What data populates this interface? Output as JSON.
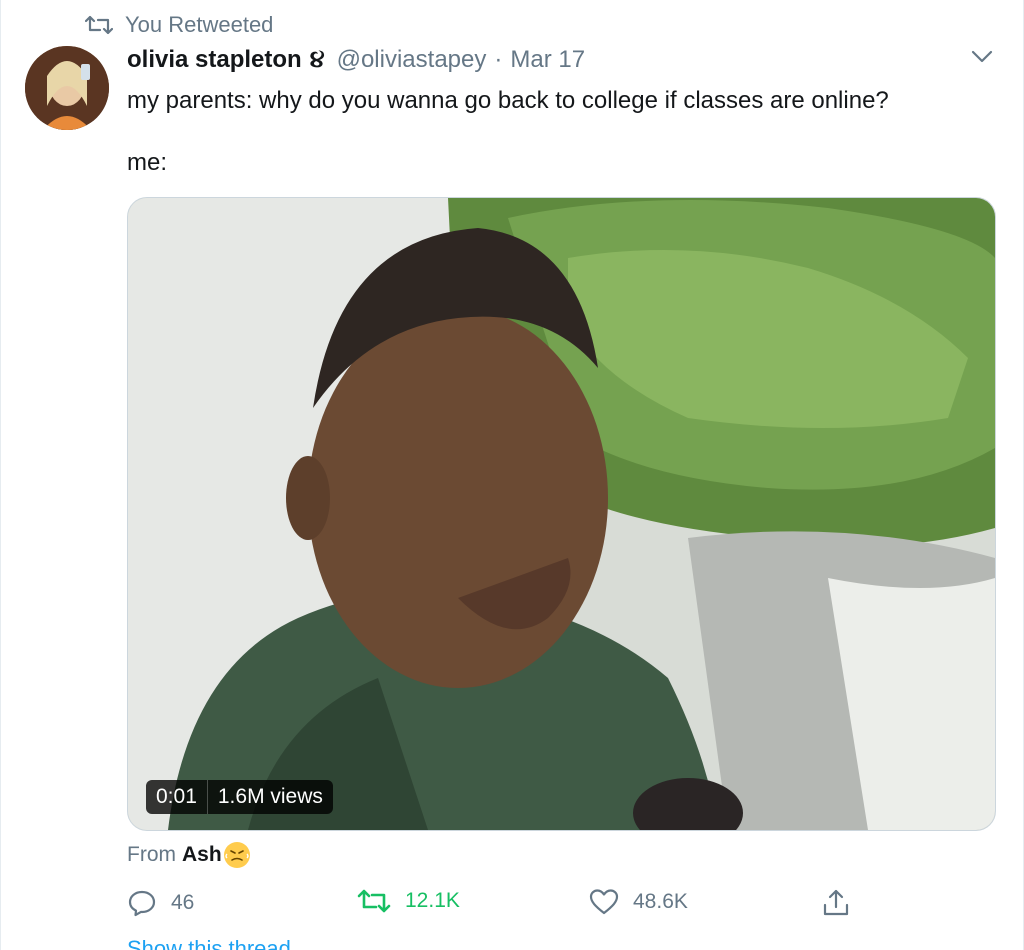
{
  "retweet": {
    "label": "You Retweeted"
  },
  "author": {
    "name": "olivia stapleton",
    "badge_emoji": "૪",
    "handle": "@oliviastapey",
    "separator": "·",
    "date": "Mar 17"
  },
  "tweet": {
    "line1": "my parents: why do you wanna go back to college if classes are online?",
    "line2": "me:"
  },
  "media": {
    "time": "0:01",
    "views": "1.6M views"
  },
  "from": {
    "prefix": "From",
    "name": "Ash"
  },
  "actions": {
    "replies": "46",
    "retweets": "12.1K",
    "likes": "48.6K"
  },
  "footer": {
    "show_thread": "Show this thread"
  },
  "colors": {
    "retweet_green": "#17bf63",
    "muted_gray": "#657786",
    "link_blue": "#1da1f2"
  },
  "icons": [
    "retweet-icon",
    "chevron-down-icon",
    "reply-icon",
    "retweet-icon",
    "heart-icon",
    "share-icon"
  ]
}
